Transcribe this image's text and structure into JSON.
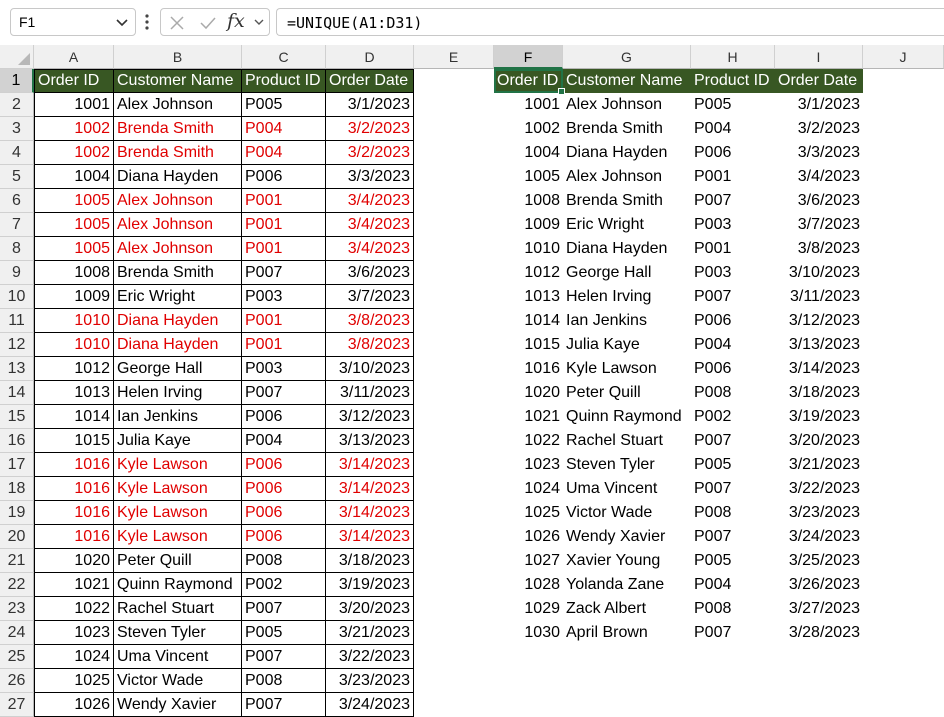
{
  "formula_bar": {
    "name_box": "F1",
    "formula": "=UNIQUE(A1:D31)",
    "fx_label": "fx"
  },
  "columns": [
    "A",
    "B",
    "C",
    "D",
    "E",
    "F",
    "G",
    "H",
    "I",
    "J"
  ],
  "rows": [
    "1",
    "2",
    "3",
    "4",
    "5",
    "6",
    "7",
    "8",
    "9",
    "10",
    "11",
    "12",
    "13",
    "14",
    "15",
    "16",
    "17",
    "18",
    "19",
    "20",
    "21",
    "22",
    "23",
    "24",
    "25",
    "26",
    "27"
  ],
  "selected_cell": "F1",
  "colors": {
    "header_fill": "#385723",
    "duplicate_text": "#e00000",
    "selection": "#217346"
  },
  "source_table": {
    "headers": [
      "Order ID",
      "Customer Name",
      "Product ID",
      "Order Date"
    ],
    "rows": [
      {
        "id": "1001",
        "name": "Alex Johnson",
        "product": "P005",
        "date": "3/1/2023",
        "dup": false
      },
      {
        "id": "1002",
        "name": "Brenda Smith",
        "product": "P004",
        "date": "3/2/2023",
        "dup": true
      },
      {
        "id": "1002",
        "name": "Brenda Smith",
        "product": "P004",
        "date": "3/2/2023",
        "dup": true
      },
      {
        "id": "1004",
        "name": "Diana Hayden",
        "product": "P006",
        "date": "3/3/2023",
        "dup": false
      },
      {
        "id": "1005",
        "name": "Alex Johnson",
        "product": "P001",
        "date": "3/4/2023",
        "dup": true
      },
      {
        "id": "1005",
        "name": "Alex Johnson",
        "product": "P001",
        "date": "3/4/2023",
        "dup": true
      },
      {
        "id": "1005",
        "name": "Alex Johnson",
        "product": "P001",
        "date": "3/4/2023",
        "dup": true
      },
      {
        "id": "1008",
        "name": "Brenda Smith",
        "product": "P007",
        "date": "3/6/2023",
        "dup": false
      },
      {
        "id": "1009",
        "name": "Eric Wright",
        "product": "P003",
        "date": "3/7/2023",
        "dup": false
      },
      {
        "id": "1010",
        "name": "Diana Hayden",
        "product": "P001",
        "date": "3/8/2023",
        "dup": true
      },
      {
        "id": "1010",
        "name": "Diana Hayden",
        "product": "P001",
        "date": "3/8/2023",
        "dup": true
      },
      {
        "id": "1012",
        "name": "George Hall",
        "product": "P003",
        "date": "3/10/2023",
        "dup": false
      },
      {
        "id": "1013",
        "name": "Helen Irving",
        "product": "P007",
        "date": "3/11/2023",
        "dup": false
      },
      {
        "id": "1014",
        "name": "Ian Jenkins",
        "product": "P006",
        "date": "3/12/2023",
        "dup": false
      },
      {
        "id": "1015",
        "name": "Julia Kaye",
        "product": "P004",
        "date": "3/13/2023",
        "dup": false
      },
      {
        "id": "1016",
        "name": "Kyle Lawson",
        "product": "P006",
        "date": "3/14/2023",
        "dup": true
      },
      {
        "id": "1016",
        "name": "Kyle Lawson",
        "product": "P006",
        "date": "3/14/2023",
        "dup": true
      },
      {
        "id": "1016",
        "name": "Kyle Lawson",
        "product": "P006",
        "date": "3/14/2023",
        "dup": true
      },
      {
        "id": "1016",
        "name": "Kyle Lawson",
        "product": "P006",
        "date": "3/14/2023",
        "dup": true
      },
      {
        "id": "1020",
        "name": "Peter Quill",
        "product": "P008",
        "date": "3/18/2023",
        "dup": false
      },
      {
        "id": "1021",
        "name": "Quinn Raymond",
        "product": "P002",
        "date": "3/19/2023",
        "dup": false
      },
      {
        "id": "1022",
        "name": "Rachel Stuart",
        "product": "P007",
        "date": "3/20/2023",
        "dup": false
      },
      {
        "id": "1023",
        "name": "Steven Tyler",
        "product": "P005",
        "date": "3/21/2023",
        "dup": false
      },
      {
        "id": "1024",
        "name": "Uma Vincent",
        "product": "P007",
        "date": "3/22/2023",
        "dup": false
      },
      {
        "id": "1025",
        "name": "Victor Wade",
        "product": "P008",
        "date": "3/23/2023",
        "dup": false
      },
      {
        "id": "1026",
        "name": "Wendy Xavier",
        "product": "P007",
        "date": "3/24/2023",
        "dup": false
      }
    ]
  },
  "unique_table": {
    "headers": [
      "Order ID",
      "Customer Name",
      "Product ID",
      "Order Date"
    ],
    "rows": [
      {
        "id": "1001",
        "name": "Alex Johnson",
        "product": "P005",
        "date": "3/1/2023"
      },
      {
        "id": "1002",
        "name": "Brenda Smith",
        "product": "P004",
        "date": "3/2/2023"
      },
      {
        "id": "1004",
        "name": "Diana Hayden",
        "product": "P006",
        "date": "3/3/2023"
      },
      {
        "id": "1005",
        "name": "Alex Johnson",
        "product": "P001",
        "date": "3/4/2023"
      },
      {
        "id": "1008",
        "name": "Brenda Smith",
        "product": "P007",
        "date": "3/6/2023"
      },
      {
        "id": "1009",
        "name": "Eric Wright",
        "product": "P003",
        "date": "3/7/2023"
      },
      {
        "id": "1010",
        "name": "Diana Hayden",
        "product": "P001",
        "date": "3/8/2023"
      },
      {
        "id": "1012",
        "name": "George Hall",
        "product": "P003",
        "date": "3/10/2023"
      },
      {
        "id": "1013",
        "name": "Helen Irving",
        "product": "P007",
        "date": "3/11/2023"
      },
      {
        "id": "1014",
        "name": "Ian Jenkins",
        "product": "P006",
        "date": "3/12/2023"
      },
      {
        "id": "1015",
        "name": "Julia Kaye",
        "product": "P004",
        "date": "3/13/2023"
      },
      {
        "id": "1016",
        "name": "Kyle Lawson",
        "product": "P006",
        "date": "3/14/2023"
      },
      {
        "id": "1020",
        "name": "Peter Quill",
        "product": "P008",
        "date": "3/18/2023"
      },
      {
        "id": "1021",
        "name": "Quinn Raymond",
        "product": "P002",
        "date": "3/19/2023"
      },
      {
        "id": "1022",
        "name": "Rachel Stuart",
        "product": "P007",
        "date": "3/20/2023"
      },
      {
        "id": "1023",
        "name": "Steven Tyler",
        "product": "P005",
        "date": "3/21/2023"
      },
      {
        "id": "1024",
        "name": "Uma Vincent",
        "product": "P007",
        "date": "3/22/2023"
      },
      {
        "id": "1025",
        "name": "Victor Wade",
        "product": "P008",
        "date": "3/23/2023"
      },
      {
        "id": "1026",
        "name": "Wendy Xavier",
        "product": "P007",
        "date": "3/24/2023"
      },
      {
        "id": "1027",
        "name": "Xavier Young",
        "product": "P005",
        "date": "3/25/2023"
      },
      {
        "id": "1028",
        "name": "Yolanda Zane",
        "product": "P004",
        "date": "3/26/2023"
      },
      {
        "id": "1029",
        "name": "Zack Albert",
        "product": "P008",
        "date": "3/27/2023"
      },
      {
        "id": "1030",
        "name": "April Brown",
        "product": "P007",
        "date": "3/28/2023"
      }
    ]
  }
}
